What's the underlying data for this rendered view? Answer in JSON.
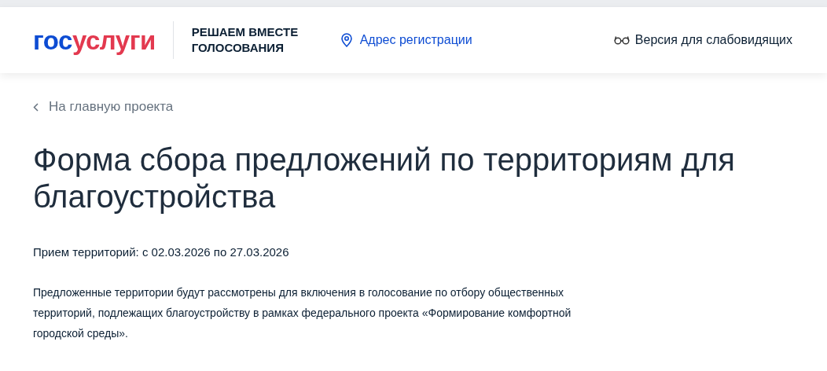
{
  "header": {
    "logo": {
      "part_1": "гос",
      "part_2": "услуги"
    },
    "project_title": [
      "РЕШАЕМ ВМЕСТЕ",
      "ГОЛОСОВАНИЯ"
    ],
    "address_link": "Адрес регистрации",
    "accessibility_link": "Версия для слабовидящих"
  },
  "back_link": "На главную проекта",
  "title": "Форма сбора предложений по территориям для благоустройства",
  "dates": "Прием территорий: с 02.03.2026 по 27.03.2026",
  "description": "Предложенные территории будут рассмотрены для включения в голосование по отбору общественных территорий, подлежащих благоустройству в рамках федерального проекта «Формирование комфортной городской среды»."
}
